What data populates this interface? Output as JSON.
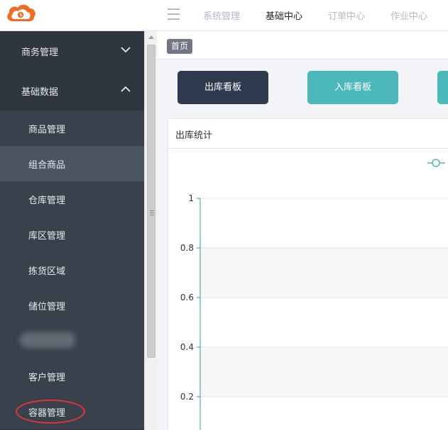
{
  "header": {
    "logo_icon": "cloud-logo-icon",
    "menu_icon": "hamburger-menu-icon",
    "nav": [
      {
        "label": "系统管理",
        "active": false
      },
      {
        "label": "基础中心",
        "active": true
      },
      {
        "label": "订单中心",
        "active": false
      },
      {
        "label": "作业中心",
        "active": false
      }
    ]
  },
  "sidebar": {
    "groups": [
      {
        "label": "商务管理",
        "expanded": false
      },
      {
        "label": "基础数据",
        "expanded": true
      }
    ],
    "items": [
      {
        "label": "商品管理"
      },
      {
        "label": "组合商品",
        "active": true
      },
      {
        "label": "仓库管理"
      },
      {
        "label": "库区管理"
      },
      {
        "label": "拣货区域"
      },
      {
        "label": "储位管理"
      },
      {
        "label": ""
      },
      {
        "label": "客户管理"
      },
      {
        "label": "容器管理"
      }
    ]
  },
  "breadcrumb": {
    "home": "首页"
  },
  "boards": {
    "outbound": "出库看板",
    "inbound": "入库看板"
  },
  "card": {
    "title": "出库统计"
  },
  "colors": {
    "sidebar_bg": "#2f363f",
    "accent_teal": "#4db8ba",
    "dark_button": "#303a4f",
    "annotation_red": "#e8333b"
  },
  "chart_data": {
    "type": "line",
    "title": "",
    "xlabel": "",
    "ylabel": "",
    "y_ticks": [
      "1",
      "0.8",
      "0.6",
      "0.4",
      "0.2"
    ],
    "ylim": [
      0,
      1
    ],
    "series": [
      {
        "values": []
      }
    ],
    "grid": true,
    "legend": "top-right"
  }
}
